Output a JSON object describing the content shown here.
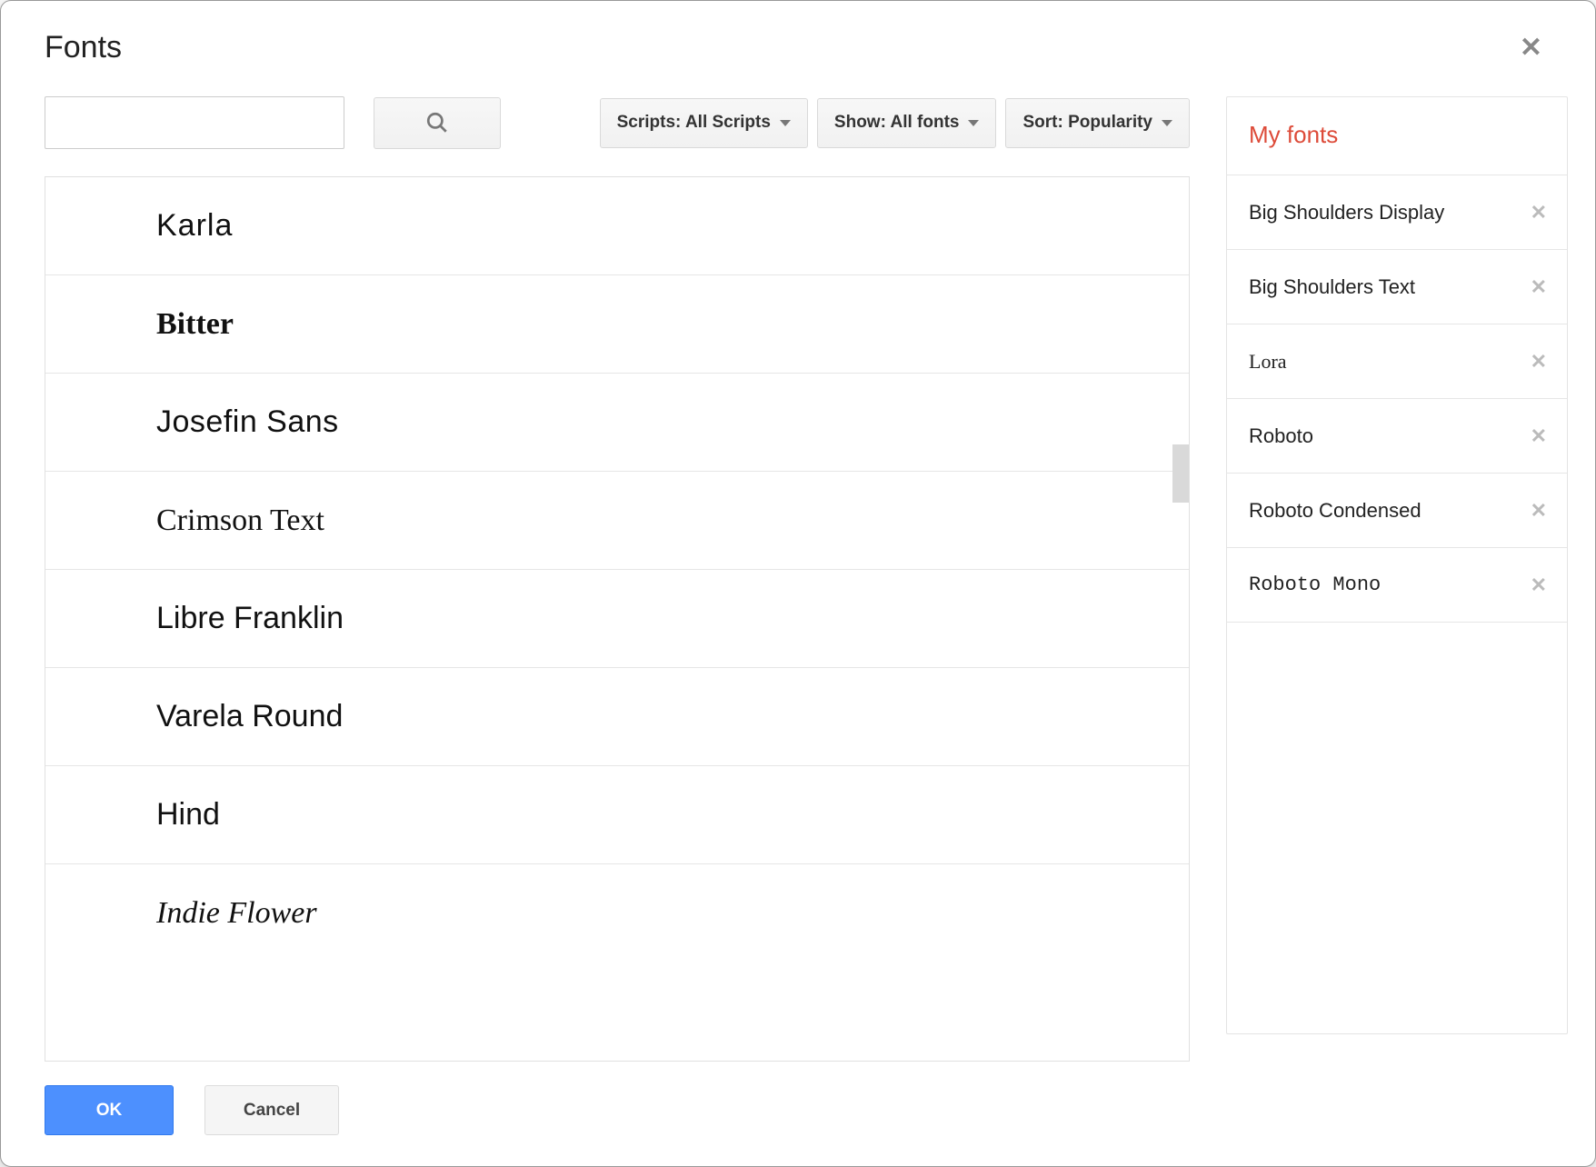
{
  "dialog": {
    "title": "Fonts"
  },
  "toolbar": {
    "search_value": "",
    "search_placeholder": "",
    "filters": {
      "scripts": "Scripts: All Scripts",
      "show": "Show: All fonts",
      "sort": "Sort: Popularity"
    }
  },
  "font_list": [
    {
      "name": "Karla",
      "css": "f-karla"
    },
    {
      "name": "Bitter",
      "css": "f-bitter"
    },
    {
      "name": "Josefin Sans",
      "css": "f-josefin"
    },
    {
      "name": "Crimson Text",
      "css": "f-crimson"
    },
    {
      "name": "Libre Franklin",
      "css": "f-libre"
    },
    {
      "name": "Varela Round",
      "css": "f-varela"
    },
    {
      "name": "Hind",
      "css": "f-hind"
    },
    {
      "name": "Indie Flower",
      "css": "f-indie"
    }
  ],
  "my_fonts": {
    "title": "My fonts",
    "items": [
      {
        "name": "Big Shoulders Display",
        "css": "mf-big"
      },
      {
        "name": "Big Shoulders Text",
        "css": "mf-big"
      },
      {
        "name": "Lora",
        "css": "mf-lora"
      },
      {
        "name": "Roboto",
        "css": "mf-roboto"
      },
      {
        "name": "Roboto Condensed",
        "css": "mf-condensed"
      },
      {
        "name": "Roboto Mono",
        "css": "mf-mono"
      }
    ]
  },
  "footer": {
    "ok": "OK",
    "cancel": "Cancel"
  }
}
